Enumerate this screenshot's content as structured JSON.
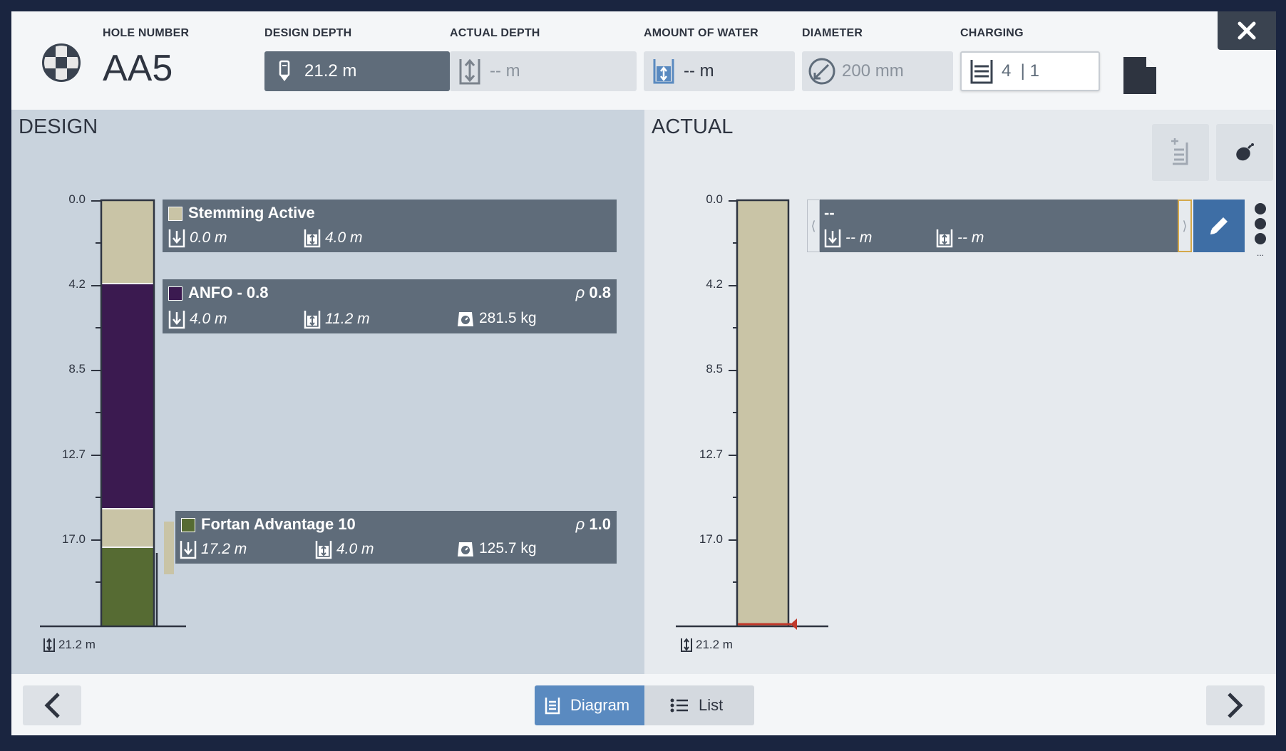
{
  "header": {
    "hole_number_label": "HOLE NUMBER",
    "hole_number": "AA5",
    "design_depth_label": "DESIGN DEPTH",
    "design_depth_value": "21.2 m",
    "actual_depth_label": "ACTUAL DEPTH",
    "actual_depth_value": "-- m",
    "water_label": "AMOUNT OF WATER",
    "water_value": "-- m",
    "diameter_label": "DIAMETER",
    "diameter_value": "200 mm",
    "charging_label": "CHARGING",
    "charging_value": "4  | 1"
  },
  "design": {
    "title": "DESIGN",
    "axis_ticks": [
      "0.0",
      "4.2",
      "8.5",
      "12.7",
      "17.0"
    ],
    "total_depth": "21.2 m",
    "decks": [
      {
        "name": "Stemming Active",
        "color": "#c9c4a6",
        "top": "0.0 m",
        "length": "4.0 m",
        "weight": "",
        "density_symbol": "",
        "density": ""
      },
      {
        "name": "ANFO - 0.8",
        "color": "#3b1a50",
        "top": "4.0 m",
        "length": "11.2 m",
        "weight": "281.5 kg",
        "density_symbol": "ρ",
        "density": "0.8"
      },
      {
        "name": "Fortan Advantage 10",
        "color": "#566b33",
        "top": "17.2 m",
        "length": "4.0 m",
        "weight": "125.7 kg",
        "density_symbol": "ρ",
        "density": "1.0"
      }
    ]
  },
  "actual": {
    "title": "ACTUAL",
    "axis_ticks": [
      "0.0",
      "4.2",
      "8.5",
      "12.7",
      "17.0"
    ],
    "total_depth": "21.2 m",
    "deck": {
      "name": "--",
      "top": "-- m",
      "length": "-- m",
      "more": "..."
    }
  },
  "footer": {
    "diagram_label": "Diagram",
    "list_label": "List"
  },
  "colors": {
    "accent": "#5a8ac0",
    "edit_button": "#3e6ea5",
    "deck_bg": "#5f6c7a",
    "marker": "#c0392b"
  }
}
